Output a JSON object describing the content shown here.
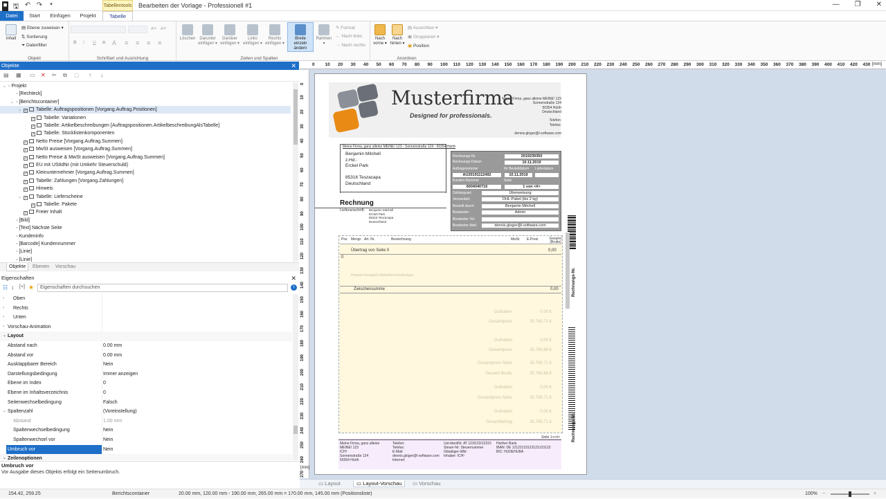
{
  "titlebar": {
    "context_tab": "Tabellentools",
    "title": "Bearbeiten der Vorlage - Professionell #1",
    "controls": [
      "—",
      "❐",
      "✕"
    ]
  },
  "tabs": [
    "Datei",
    "Start",
    "Einfügen",
    "Projekt",
    "Tabelle"
  ],
  "ribbon": {
    "objekt": {
      "label": "Objekt",
      "inhalt": "Inhalt",
      "ebene": "Ebene zuweisen ▾",
      "sortierung": "Sortierung",
      "datenfilter": "Datenfilter"
    },
    "schrift": {
      "label": "Schriftart und Ausrichtung",
      "font_buttons": [
        "B",
        "I",
        "U",
        "S"
      ],
      "grow": "A˄",
      "shrink": "A˅"
    },
    "zeilen": {
      "label": "Zeilen und Spalten",
      "buttons": [
        {
          "line1": "Löschen",
          "line2": ""
        },
        {
          "line1": "Darunter",
          "line2": "einfügen ▾"
        },
        {
          "line1": "Darüber",
          "line2": "einfügen ▾"
        },
        {
          "line1": "Links",
          "line2": "einfügen ▾"
        },
        {
          "line1": "Rechts",
          "line2": "einfügen ▾"
        },
        {
          "line1": "Breite einzeln",
          "line2": "ändern"
        },
        {
          "line1": "Rahmen",
          "line2": "▾"
        }
      ],
      "small": [
        "Format",
        "Nach links",
        "Nach rechts"
      ]
    },
    "anordnen": {
      "label": "Anordnen",
      "vorne": {
        "line1": "Nach",
        "line2": "vorne ▾"
      },
      "hinten": {
        "line1": "Nach",
        "line2": "hinten ▾"
      },
      "small": [
        "Ausrichten ▾",
        "Gruppieren ▾",
        "Position"
      ]
    }
  },
  "objects_panel": {
    "title": "Objekte",
    "tree": [
      {
        "label": "Projekt",
        "level": 0,
        "exp": "⌄",
        "cb": false
      },
      {
        "label": "[Rechteck]",
        "level": 1,
        "exp": "",
        "cb": false
      },
      {
        "label": "[Berichtscontainer]",
        "level": 1,
        "exp": "⌄",
        "cb": false
      },
      {
        "label": "Tabelle: Auftragspositionen [Vorgang.Auftrag.Positionen]",
        "level": 2,
        "exp": "⌄",
        "cb": true,
        "sel": true
      },
      {
        "label": "Tabelle: Variationen",
        "level": 3,
        "exp": "",
        "cb": true
      },
      {
        "label": "Tabelle: Artikelbeschreibungen [Auftragspositionen.ArtikelbeschreibungAlsTabelle]",
        "level": 3,
        "exp": "",
        "cb": true
      },
      {
        "label": "Tabelle: Stücklistenkomponenten",
        "level": 3,
        "exp": "",
        "cb": true
      },
      {
        "label": "Netto Preise [Vorgang.Auftrag.Summen]",
        "level": 2,
        "exp": "",
        "cb": true
      },
      {
        "label": "MwSt ausweisen [Vorgang.Auftrag.Summen]",
        "level": 2,
        "exp": "",
        "cb": true
      },
      {
        "label": "Netto Preise & MwSt ausweisen [Vorgang.Auftrag.Summen]",
        "level": 2,
        "exp": "",
        "cb": true
      },
      {
        "label": "EU mit UStIdNr (mit Umkehr Steuerschuld)",
        "level": 2,
        "exp": "",
        "cb": true
      },
      {
        "label": "Kleinunternehmer [Vorgang.Auftrag.Summen]",
        "level": 2,
        "exp": "",
        "cb": true
      },
      {
        "label": "Tabelle: Zahlungen [Vorgang.Zahlungen]",
        "level": 2,
        "exp": "",
        "cb": true
      },
      {
        "label": "Hinweis",
        "level": 2,
        "exp": "",
        "cb": true
      },
      {
        "label": "Tabelle: Lieferscheine",
        "level": 2,
        "exp": "⌄",
        "cb": true
      },
      {
        "label": "Tabelle: Pakete",
        "level": 3,
        "exp": "",
        "cb": true
      },
      {
        "label": "Freier Inhalt",
        "level": 2,
        "exp": "",
        "cb": true
      },
      {
        "label": "[Bild]",
        "level": 1,
        "exp": "",
        "cb": false
      },
      {
        "label": "[Text] Nächste Seite",
        "level": 1,
        "exp": "",
        "cb": false
      },
      {
        "label": "Kundeninfo",
        "level": 1,
        "exp": "",
        "cb": false
      },
      {
        "label": "[Barcode] Kundennummer",
        "level": 1,
        "exp": "",
        "cb": false
      },
      {
        "label": "[Linie]",
        "level": 1,
        "exp": "",
        "cb": false
      },
      {
        "label": "[Linie]",
        "level": 1,
        "exp": "",
        "cb": false
      }
    ],
    "tabs": [
      "Objekte",
      "Ebenen",
      "Vorschau"
    ]
  },
  "props_panel": {
    "title": "Eigenschaften",
    "search_placeholder": "Eigenschaften durchsuchen",
    "rows": [
      {
        "k": "Oben",
        "v": "",
        "type": "sub"
      },
      {
        "k": "Rechts",
        "v": "",
        "type": "sub"
      },
      {
        "k": "Unten",
        "v": "",
        "type": "sub"
      },
      {
        "k": "Vorschau-Animation",
        "v": "",
        "type": "top"
      },
      {
        "k": "Layout",
        "v": "",
        "type": "cat"
      },
      {
        "k": "Abstand nach",
        "v": "0.00 mm",
        "type": "n"
      },
      {
        "k": "Abstand vor",
        "v": "0.00 mm",
        "type": "n"
      },
      {
        "k": "Ausklappbarer Bereich",
        "v": "Nein",
        "type": "n"
      },
      {
        "k": "Darstellungsbedingung",
        "v": "Immer anzeigen",
        "type": "n"
      },
      {
        "k": "Ebene im Index",
        "v": "0",
        "type": "n"
      },
      {
        "k": "Ebene im Inhaltsverzeichnis",
        "v": "0",
        "type": "n"
      },
      {
        "k": "Seitenwechselbedingung",
        "v": "Falsch",
        "type": "n"
      },
      {
        "k": "Spaltenzahl",
        "v": "(Voreinstellung)",
        "type": "exp"
      },
      {
        "k": "Abstand",
        "v": "1.00 mm",
        "type": "dim"
      },
      {
        "k": "Spaltenwechselbedingung",
        "v": "Nein",
        "type": "sub2"
      },
      {
        "k": "Spaltenwechsel vor",
        "v": "Nein",
        "type": "sub2"
      },
      {
        "k": "Umbruch vor",
        "v": "Nein",
        "type": "sel"
      },
      {
        "k": "Zeilenoptionen",
        "v": "",
        "type": "cat"
      }
    ],
    "desc_title": "Umbruch vor",
    "desc_text": "Vor Ausgabe dieses Objekts erfolgt ein Seitenumbruch."
  },
  "ruler": {
    "unit": "[mm]",
    "h": [
      "0",
      "10",
      "20",
      "30",
      "40",
      "50",
      "60",
      "70",
      "80",
      "90",
      "100",
      "110",
      "120",
      "130",
      "140",
      "150",
      "160",
      "170",
      "180",
      "190",
      "200",
      "210",
      "220",
      "230",
      "240",
      "250",
      "260",
      "270",
      "280",
      "290",
      "300",
      "310",
      "320",
      "330",
      "340",
      "350",
      "360",
      "370",
      "380",
      "390",
      "400",
      "410",
      "420",
      "430"
    ],
    "v": [
      "0",
      "10",
      "20",
      "30",
      "40",
      "50",
      "60",
      "70",
      "80",
      "90",
      "100",
      "110",
      "120",
      "130",
      "140",
      "150",
      "160",
      "170",
      "180",
      "190",
      "200",
      "210",
      "220",
      "230",
      "240",
      "250",
      "260",
      "270"
    ]
  },
  "document": {
    "logo_name": "Musterfirma",
    "logo_slogan": "Designed for professionals.",
    "sender_block": [
      "Meine Firma, ganz alleine MEINE! 123",
      "Sonnenstraße 124",
      "50354 Hürth",
      "Deutschland",
      "",
      "Telefon:",
      "Telefax:",
      "",
      "dennis.gloger@l-software.com"
    ],
    "sender_line": "Meine Firma, ganz alleine MEINE! 123 - Sonnenstraße 124 - 50354 Hürth",
    "recipient": [
      "Benjamin Mitchell",
      "z.Hd.:",
      "Erckel Park",
      "",
      "85316 Teszacapa",
      "Deutschland"
    ],
    "heading": "Rechnung",
    "lieferanschrift_label": "Lieferanschrift:",
    "lieferanschrift": [
      "Benjamin Mitchell",
      "Erckel Park",
      "85316 Teszacapa",
      "Deutschland"
    ],
    "info": {
      "rechnungsnr_label": "Rechnungs-Nr.",
      "rechnungsnr": "2019239350",
      "datum_label": "Rechnungs-Datum",
      "datum": "10.11.2019",
      "auftragsnr_label": "Auftragsnummer",
      "auftragsnr": "AU20191112492",
      "ihre_label": "Ihr Bestelldatum",
      "ihre": "10.11.2019",
      "liefer_label": "Lieferdatum",
      "kundennr_label": "Kunden-Nummer",
      "kundennr": "6004040716",
      "seite_label": "Seite",
      "seite": "1 von <#>",
      "rows": [
        {
          "k": "Zahlungsart:",
          "v": "Überweisung"
        },
        {
          "k": "Versandart:",
          "v": "DHL-Paket (bis 2 kg)"
        },
        {
          "k": "Bestellt durch:",
          "v": "Benjamin Mitchell"
        },
        {
          "k": "Bearbeiter:",
          "v": "Admin"
        },
        {
          "k": "Bearbeiter Tel:",
          "v": ""
        },
        {
          "k": "Bearbeiter Mail:",
          "v": "dennis.gloger@l-software.com"
        }
      ]
    },
    "table_header": [
      "Pos",
      "Mengr.",
      "Art. Nr.",
      "Bezeichnung",
      "MwSt",
      "E-Preis",
      "Gesamt (Brutto)"
    ],
    "uebertrag": "Übertrag von Seite 0",
    "uebertrag_val": "0,00",
    "row0": "0",
    "faint_text": "Hinweis bezüglich Artikelbeschreibungen",
    "zwischensumme": "Zwischensumme",
    "zwischensumme_val": "0,00",
    "totals": [
      {
        "k": "Guthaben",
        "v": "0,00 €"
      },
      {
        "k": "Gesamtpreis",
        "v": "35.789,71 €"
      },
      {
        "k": "Guthaben",
        "v": "0,00 €"
      },
      {
        "k": "Gesamtpreis",
        "v": "35.789,66 €"
      },
      {
        "k": "Gesamtpreis Netto",
        "v": "35.789,71 €"
      },
      {
        "k": "Gesamt Brutto",
        "v": "35.789,66 €"
      },
      {
        "k": "Guthaben",
        "v": "0,00 €"
      },
      {
        "k": "Gesamtpreis Netto",
        "v": "35.789,71 €"
      },
      {
        "k": "Guthaben",
        "v": "0,00 €"
      },
      {
        "k": "Gesamtbetrag",
        "v": "35.789,71 €"
      }
    ],
    "next_page": "Seite 1+<#>",
    "footer_cols": [
      [
        "Meine Firma, ganz alleine",
        "MEINE! 123",
        "ICH!",
        "Sonnenstraße 124",
        "50354 Hürth"
      ],
      [
        "Telefon:",
        "Telefax:",
        "E-Mail:",
        "dennis.gloger@l-software.com",
        "Internet:"
      ],
      [
        "Ust-IdentNr: AT 123/123/12315",
        "Steuer-Nr: Steuernummer",
        "Gläubiger-IdNr:",
        "Inhaber: ICH!"
      ],
      [
        "Hürther Bank",
        "IBAN: DE 12123123123123123123",
        "BIC: HUDEHUBA"
      ]
    ],
    "barcode_label_top": "Rechnungs-Nr.",
    "barcode_label_bottom": "Rechnungs-Nr."
  },
  "view_tabs": [
    "Layout",
    "Layout-Vorschau",
    "Vorschau"
  ],
  "status": {
    "coords": "154.42, 259.25",
    "object": "Berichtscontainer",
    "geometry": "20.00 mm, 120.00 mm - 190.00 mm, 265.00 mm = 170.00 mm, 145.00 mm (Positionsliste)",
    "zoom": "100%"
  }
}
